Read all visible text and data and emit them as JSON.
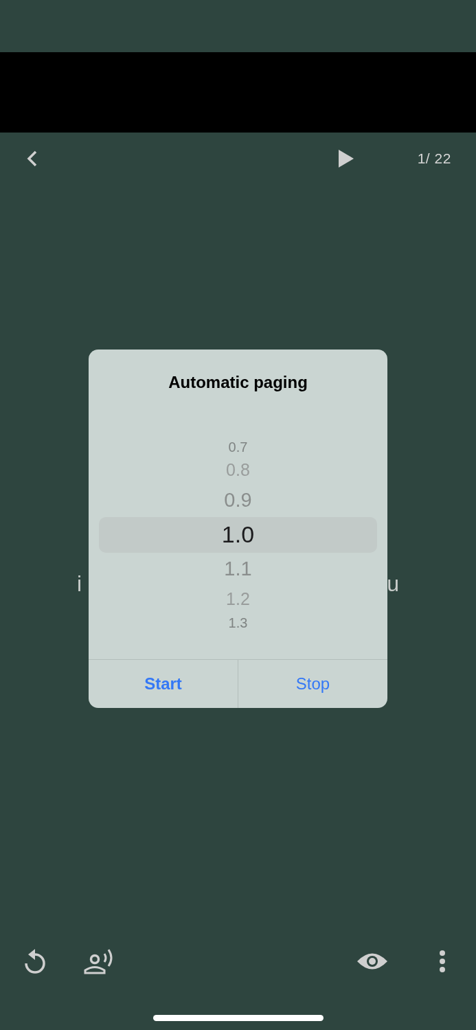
{
  "toolbar": {
    "page_counter": "1/ 22"
  },
  "background_text": {
    "left": "i",
    "right": "u"
  },
  "dialog": {
    "title": "Automatic paging",
    "picker": [
      {
        "label": "0.7",
        "selected": false
      },
      {
        "label": "0.8",
        "selected": false
      },
      {
        "label": "0.9",
        "selected": false
      },
      {
        "label": "1.0",
        "selected": true
      },
      {
        "label": "1.1",
        "selected": false
      },
      {
        "label": "1.2",
        "selected": false
      },
      {
        "label": "1.3",
        "selected": false
      }
    ],
    "buttons": [
      {
        "label": "Start",
        "kind": "primary"
      },
      {
        "label": "Stop",
        "kind": "secondary"
      }
    ]
  }
}
